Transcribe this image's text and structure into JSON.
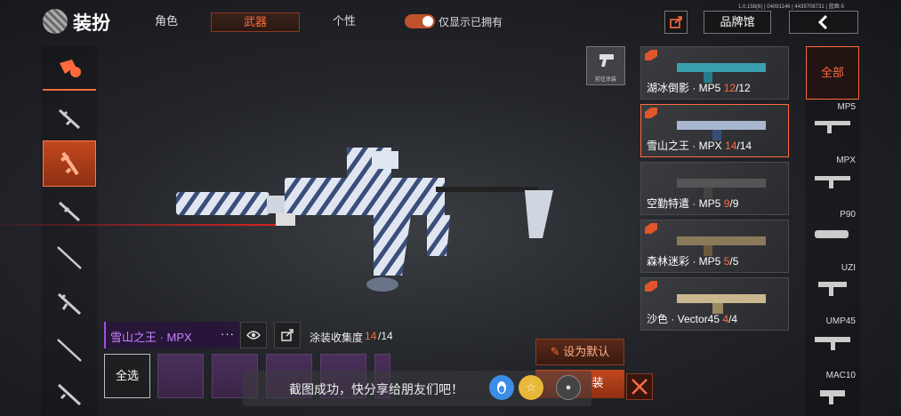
{
  "header": {
    "title": "装扮",
    "tabs": [
      {
        "label": "角色",
        "active": false
      },
      {
        "label": "武器",
        "active": true
      },
      {
        "label": "个性",
        "active": false
      }
    ],
    "toggle_label": "仅显示已拥有",
    "toggle_on": true,
    "version": "1.0.158(6) | 04091146 | 4439708731 | 蓝图-5",
    "brand_hall_label": "品牌馆"
  },
  "left_categories": [
    "logo-badge-icon",
    "assault-rifle-icon",
    "pistol-icon",
    "smg-icon",
    "sniper-rifle-icon",
    "ak-rifle-icon",
    "marksman-rifle-icon",
    "shotgun-icon"
  ],
  "goto_paint_label": "前往涂装",
  "skin_bar": {
    "name": "雪山之王 · MPX",
    "more": "···",
    "collect_label": "涂装收集度",
    "collect_count": "14",
    "collect_total": "/14"
  },
  "select_all_label": "全选",
  "skins": [
    {
      "name": "湖冰倒影 · MP5",
      "count": "12",
      "total": "/12",
      "selected": false
    },
    {
      "name": "雪山之王 · MPX",
      "count": "14",
      "total": "/14",
      "selected": true
    },
    {
      "name": "空勤特遣 · MP5",
      "count": "9",
      "total": "/9",
      "selected": false
    },
    {
      "name": "森林迷彩 · MP5",
      "count": "5",
      "total": "/5",
      "selected": false
    },
    {
      "name": "沙色 · Vector45",
      "count": "4",
      "total": "/4",
      "selected": false
    }
  ],
  "filters": {
    "all_label": "全部",
    "items": [
      "MP5",
      "MPX",
      "P90",
      "UZI",
      "UMP45",
      "MAC10"
    ]
  },
  "buttons": {
    "set_default": "设为默认",
    "equip": "装"
  },
  "toast": {
    "text": "截图成功，快分享给朋友们吧！"
  },
  "colors": {
    "accent": "#ff6a3d",
    "purple_rarity": "#c880ff"
  }
}
